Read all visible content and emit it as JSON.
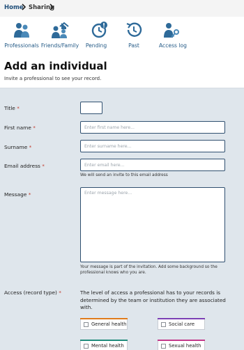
{
  "breadcrumb": {
    "home": "Home",
    "current": "Sharing"
  },
  "nav": [
    {
      "label": "Professionals",
      "icon": "professionals-icon"
    },
    {
      "label": "Friends/Family",
      "icon": "friends-family-icon"
    },
    {
      "label": "Pending",
      "icon": "pending-clock-icon"
    },
    {
      "label": "Past",
      "icon": "past-history-icon"
    },
    {
      "label": "Access log",
      "icon": "access-log-key-icon"
    }
  ],
  "header": {
    "title": "Add an individual",
    "subtitle": "Invite a professional to see your record."
  },
  "form": {
    "required_mark": "*",
    "title_label": "Title",
    "first_name_label": "First name",
    "first_name_placeholder": "Enter first name here...",
    "surname_label": "Surname",
    "surname_placeholder": "Enter surname here...",
    "email_label": "Email address",
    "email_placeholder": "Enter email here...",
    "email_hint": "We will send an invite to this email address",
    "message_label": "Message",
    "message_placeholder": "Enter message here...",
    "message_hint_line1": "Your message is part of the invitation. Add some background so the",
    "message_hint_line2": "professional knows who you are.",
    "access_label": "Access (record type)",
    "access_text": "The level of access a professional has to your records is determined by the team or institution they are associated with."
  },
  "record_types": [
    {
      "label": "General health",
      "color": "#e07b1a"
    },
    {
      "label": "Social care",
      "color": "#7b3fb5"
    },
    {
      "label": "Mental health",
      "color": "#1f8a7a"
    },
    {
      "label": "Sexual health",
      "color": "#c2388a"
    }
  ],
  "colors": {
    "accent": "#1f4e79",
    "background": "#dfe6ec"
  }
}
